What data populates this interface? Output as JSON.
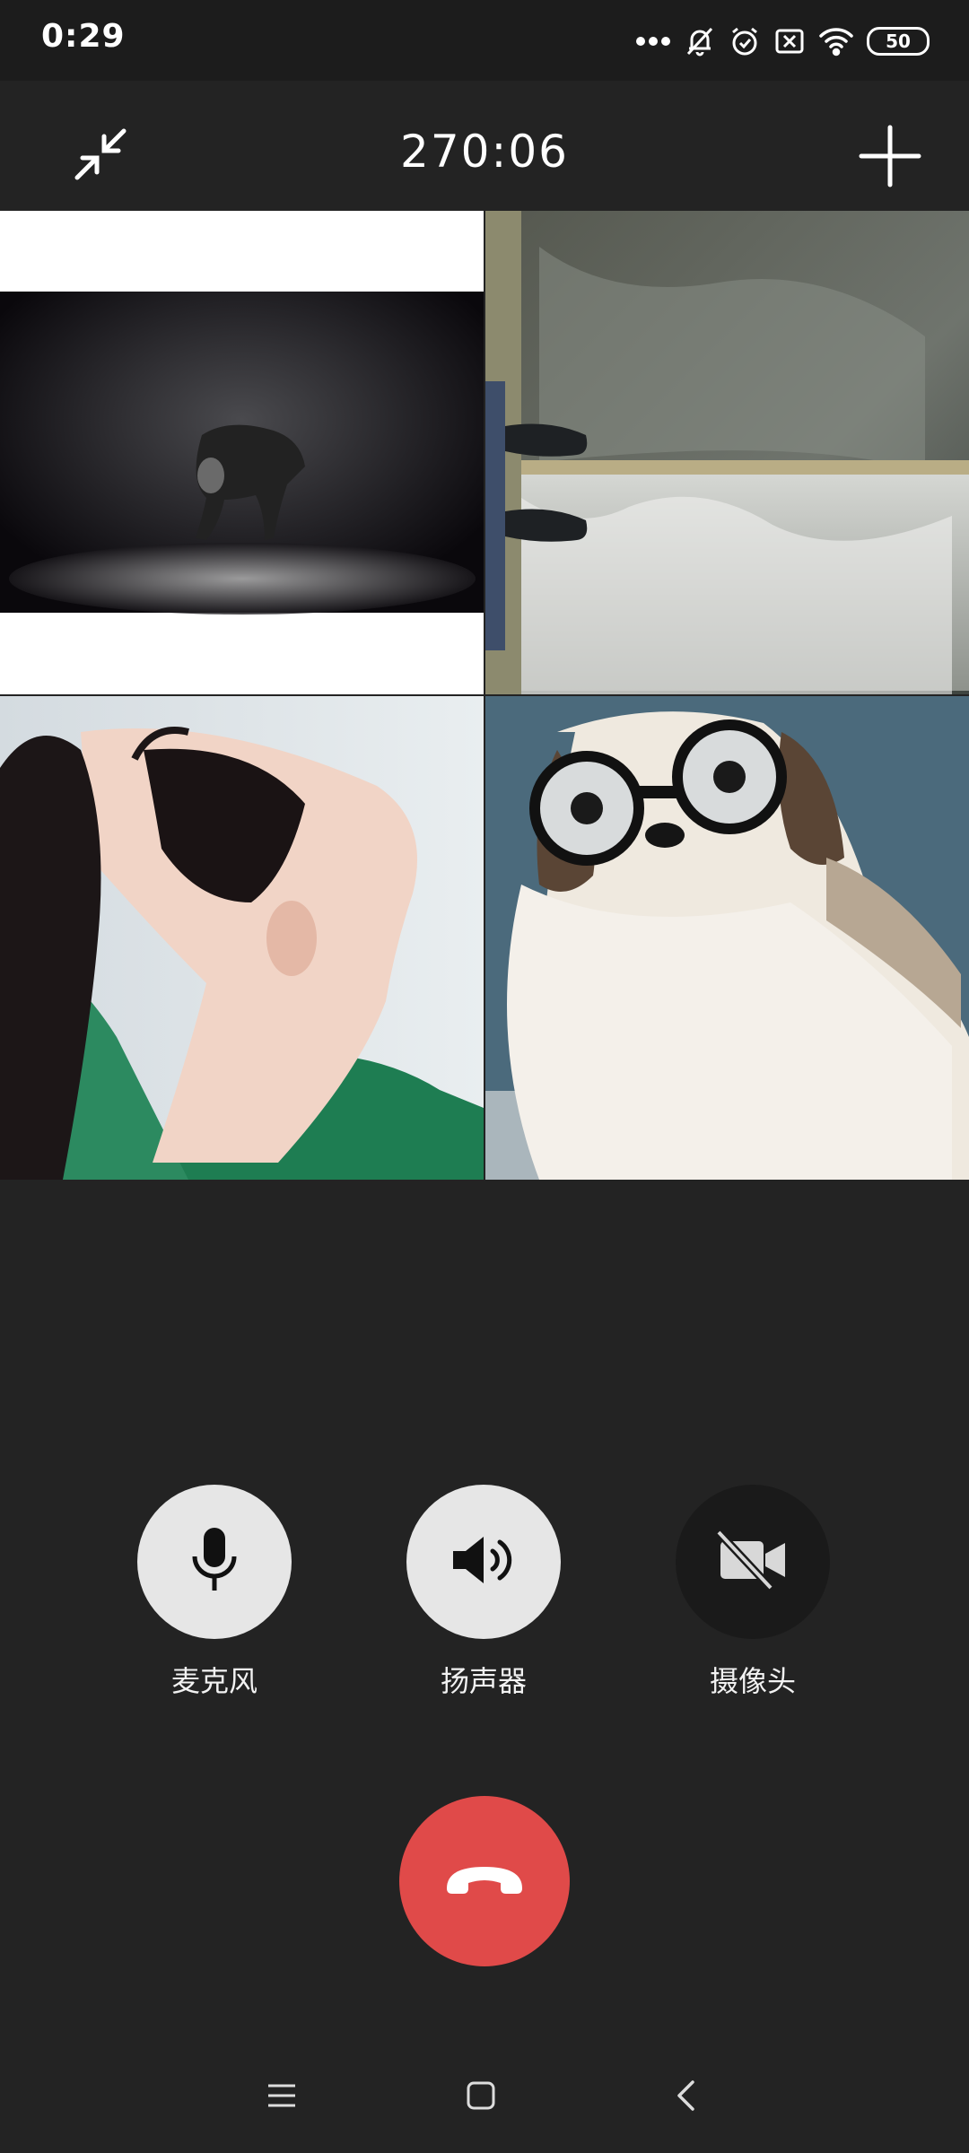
{
  "status_bar": {
    "time": "0:29",
    "battery": "50",
    "icons": [
      "more-dots-icon",
      "bell-off-icon",
      "alarm-icon",
      "sim-blocked-icon",
      "wifi-icon",
      "battery-icon"
    ]
  },
  "header": {
    "timer": "270:06",
    "icons": [
      "minimize-icon",
      "add-participant-icon"
    ]
  },
  "participants": [
    {
      "icon": "video-feed-dancer"
    },
    {
      "icon": "video-feed-waterfall-feet"
    },
    {
      "icon": "video-feed-woman-hair"
    },
    {
      "icon": "video-feed-dog-glasses"
    }
  ],
  "controls": {
    "microphone": {
      "label": "麦克风",
      "icon": "microphone-icon",
      "state": "on"
    },
    "speaker": {
      "label": "扬声器",
      "icon": "speaker-icon",
      "state": "on"
    },
    "camera": {
      "label": "摄像头",
      "icon": "camera-off-icon",
      "state": "off"
    },
    "hangup_icon": "hangup-icon"
  },
  "nav": {
    "icons": [
      "menu-icon",
      "home-icon",
      "back-icon"
    ]
  },
  "colors": {
    "background": "#232323",
    "hangup": "#e04a49",
    "control_light": "#e6e6e6",
    "control_dark": "#1a1a1a"
  }
}
